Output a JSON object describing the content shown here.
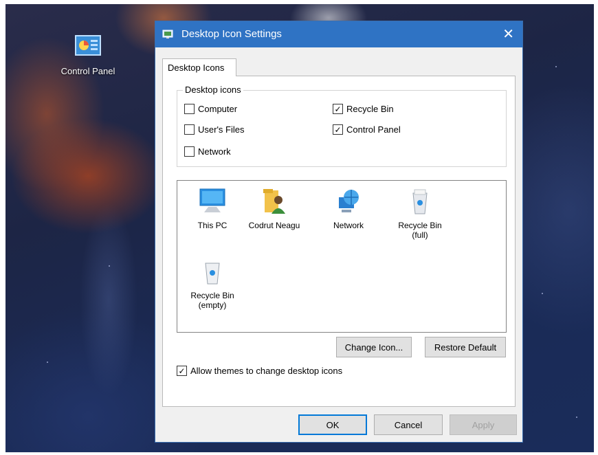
{
  "desktop": {
    "icon_label": "Control Panel"
  },
  "dialog": {
    "title": "Desktop Icon Settings",
    "close_glyph": "✕",
    "tab_label": "Desktop Icons",
    "group_label": "Desktop icons",
    "checkboxes": [
      {
        "label": "Computer",
        "checked": false
      },
      {
        "label": "User's Files",
        "checked": false
      },
      {
        "label": "Network",
        "checked": false
      },
      {
        "label": "Recycle Bin",
        "checked": true
      },
      {
        "label": "Control Panel",
        "checked": true
      }
    ],
    "icons": [
      {
        "label": "This PC",
        "icon": "monitor-icon"
      },
      {
        "label": "Codrut Neagu",
        "icon": "user-folder-icon"
      },
      {
        "label": "Network",
        "icon": "network-globe-icon"
      },
      {
        "label": "Recycle Bin\n(full)",
        "icon": "recycle-bin-full-icon"
      },
      {
        "label": "Recycle Bin\n(empty)",
        "icon": "recycle-bin-empty-icon"
      }
    ],
    "change_icon_label": "Change Icon...",
    "restore_default_label": "Restore Default",
    "allow_themes_label": "Allow themes to change desktop icons",
    "allow_themes_checked": true,
    "ok_label": "OK",
    "cancel_label": "Cancel",
    "apply_label": "Apply",
    "apply_enabled": false
  },
  "colors": {
    "titlebar": "#2f73c4",
    "default_button_border": "#0078d7"
  }
}
